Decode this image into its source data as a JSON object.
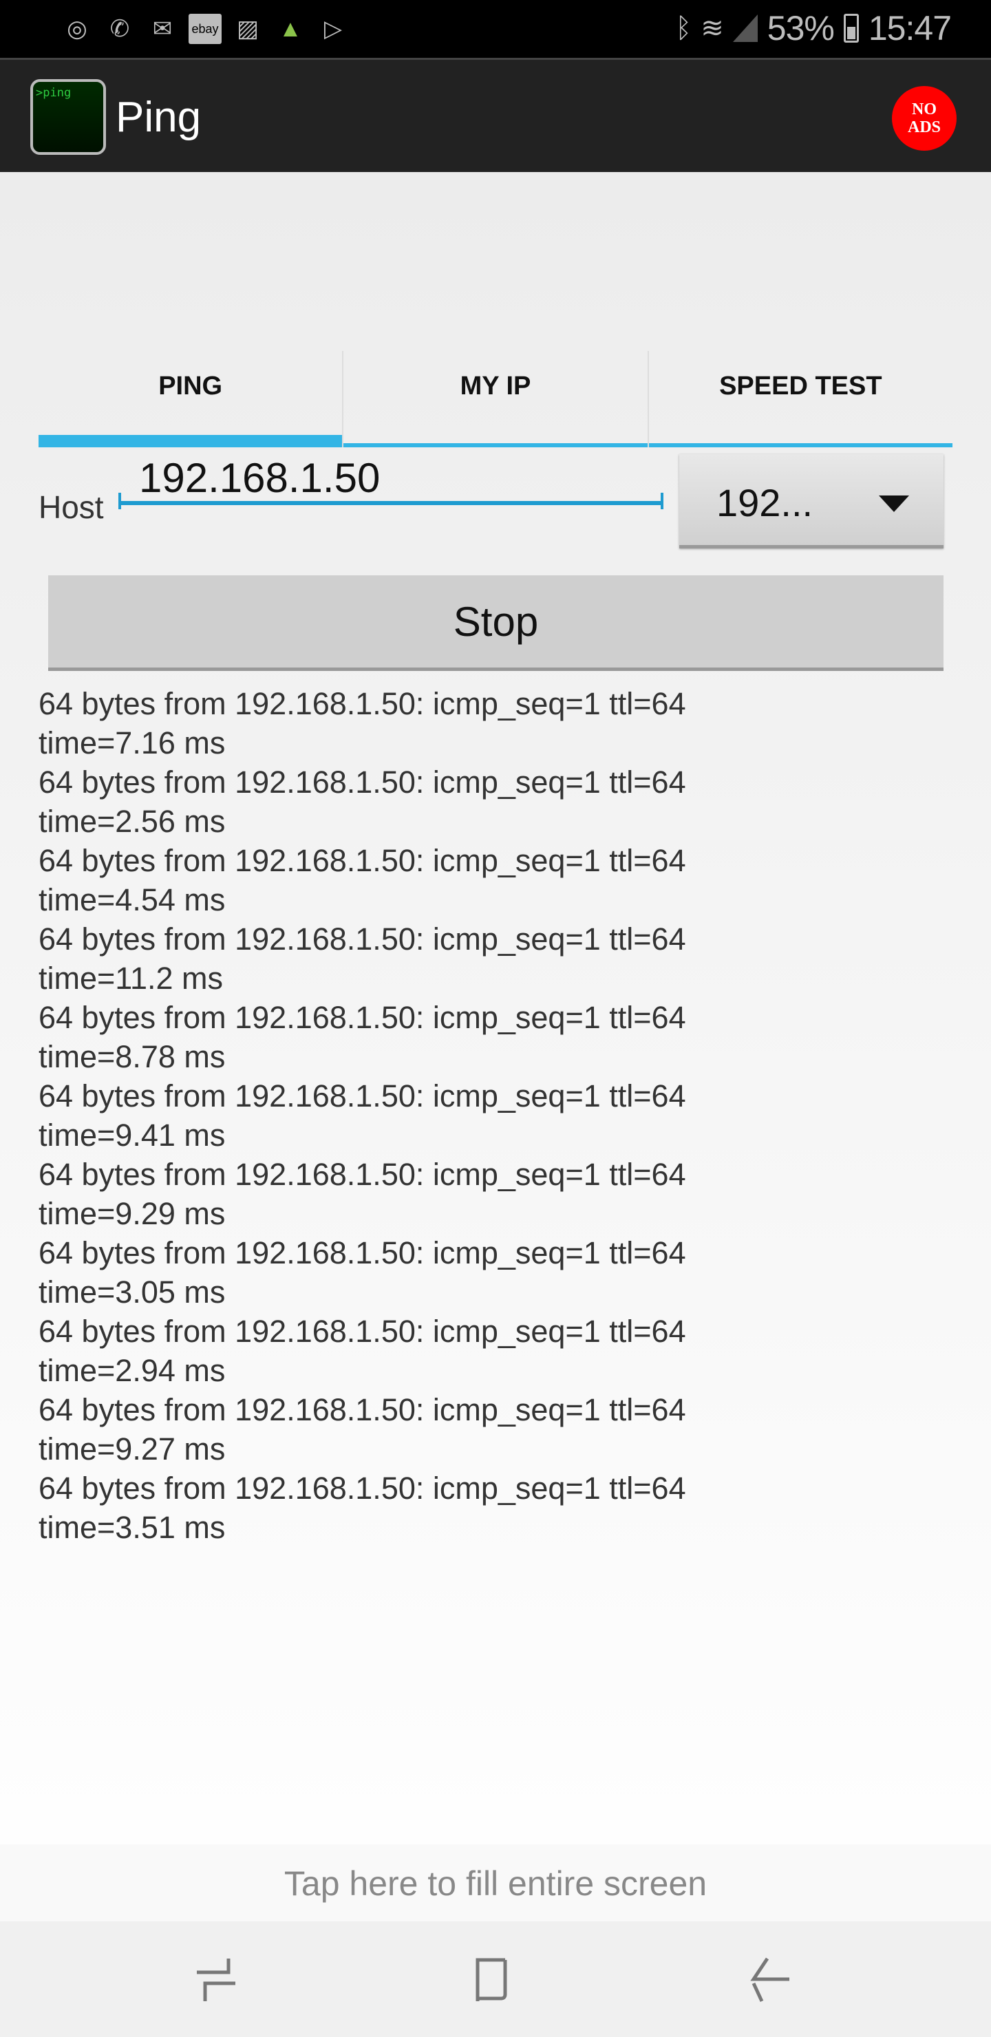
{
  "status_bar": {
    "left_icons": [
      "messenger-icon",
      "whatsapp-icon",
      "mail-icon",
      "ebay-icon",
      "image-icon",
      "android-icon",
      "play-store-icon"
    ],
    "ebay_label": "ebay",
    "right_icons": [
      "bluetooth-icon",
      "wifi-icon",
      "signal-icon",
      "battery-icon"
    ],
    "battery": "53%",
    "time": "15:47"
  },
  "app_bar": {
    "logo_text": ">ping",
    "title": "Ping",
    "no_ads_line1": "NO",
    "no_ads_line2": "ADS",
    "no_ads_color": "#ff0000"
  },
  "tabs": [
    {
      "label": "PING",
      "active": true
    },
    {
      "label": "MY IP",
      "active": false
    },
    {
      "label": "SPEED TEST",
      "active": false
    }
  ],
  "accent_color": "#33b5e5",
  "host": {
    "label": "Host",
    "value": "192.168.1.50",
    "spinner_value": "192..."
  },
  "stop_label": "Stop",
  "log": [
    "64 bytes from 192.168.1.50: icmp_seq=1 ttl=64",
    "time=7.16 ms",
    "64 bytes from 192.168.1.50: icmp_seq=1 ttl=64",
    "time=2.56 ms",
    "64 bytes from 192.168.1.50: icmp_seq=1 ttl=64",
    "time=4.54 ms",
    "64 bytes from 192.168.1.50: icmp_seq=1 ttl=64",
    "time=11.2 ms",
    "64 bytes from 192.168.1.50: icmp_seq=1 ttl=64",
    "time=8.78 ms",
    "64 bytes from 192.168.1.50: icmp_seq=1 ttl=64",
    "time=9.41 ms",
    "64 bytes from 192.168.1.50: icmp_seq=1 ttl=64",
    "time=9.29 ms",
    "64 bytes from 192.168.1.50: icmp_seq=1 ttl=64",
    "time=3.05 ms",
    "64 bytes from 192.168.1.50: icmp_seq=1 ttl=64",
    "time=2.94 ms",
    "64 bytes from 192.168.1.50: icmp_seq=1 ttl=64",
    "time=9.27 ms",
    "64 bytes from 192.168.1.50: icmp_seq=1 ttl=64",
    "time=3.51 ms"
  ],
  "fill_screen_label": "Tap here to fill entire screen",
  "nav_bar": [
    "recents-icon",
    "home-icon",
    "back-icon"
  ]
}
